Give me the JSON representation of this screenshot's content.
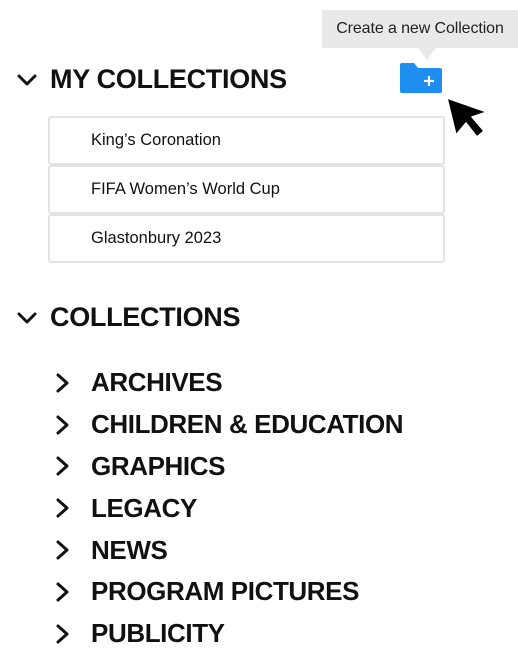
{
  "tooltip": {
    "text": "Create a new Collection"
  },
  "my_collections": {
    "heading": "MY COLLECTIONS",
    "items": [
      {
        "label": "King’s Coronation"
      },
      {
        "label": "FIFA Women’s World Cup"
      },
      {
        "label": "Glastonbury 2023"
      }
    ]
  },
  "collections": {
    "heading": "COLLECTIONS",
    "items": [
      {
        "label": "ARCHIVES"
      },
      {
        "label": "CHILDREN & EDUCATION"
      },
      {
        "label": "GRAPHICS"
      },
      {
        "label": "LEGACY"
      },
      {
        "label": "NEWS"
      },
      {
        "label": "PROGRAM PICTURES"
      },
      {
        "label": "PUBLICITY"
      }
    ]
  },
  "icons": {
    "expanded": "chevron-down-icon",
    "collapsed": "chevron-right-icon",
    "new_collection": "folder-plus-icon",
    "pointer": "mouse-pointer-icon"
  },
  "colors": {
    "accent": "#1e8ff0",
    "tooltip_bg": "#e9e9e9",
    "border": "#e3e3e3",
    "text": "#111111"
  }
}
